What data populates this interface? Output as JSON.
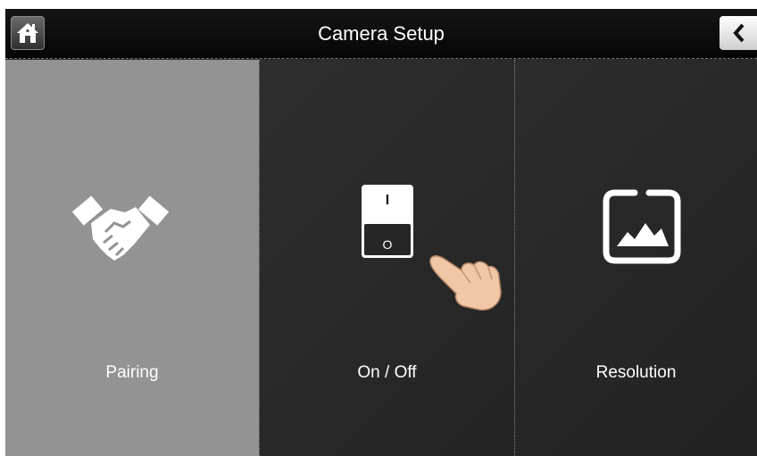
{
  "header": {
    "title": "Camera Setup",
    "home_icon": "home-icon",
    "back_icon": "chevron-left-icon"
  },
  "tiles": [
    {
      "label": "Pairing",
      "icon": "handshake-icon",
      "selected": true
    },
    {
      "label": "On / Off",
      "icon": "power-switch-icon",
      "switch_on_mark": "I",
      "switch_off_mark": "O"
    },
    {
      "label": "Resolution",
      "icon": "image-icon"
    }
  ],
  "colors": {
    "selected_tile": "#939393",
    "tile_background": "#2a2a2a",
    "header_background": "#0a0a0a",
    "text": "#ffffff"
  }
}
